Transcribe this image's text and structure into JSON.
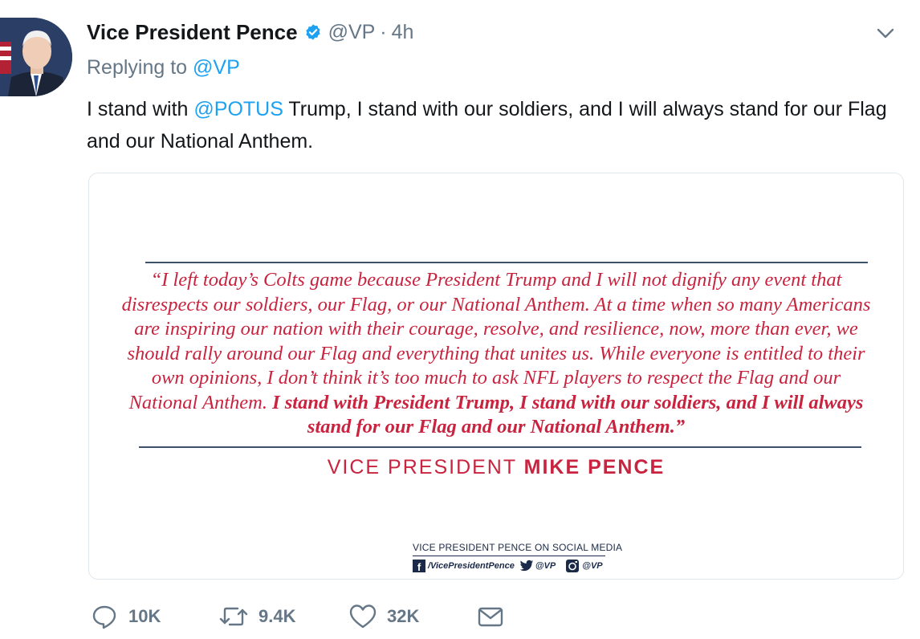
{
  "author": {
    "name": "Vice President Pence",
    "handle": "@VP",
    "separator": "·",
    "time": "4h",
    "verified": true,
    "avatar_icon": "profile-photo"
  },
  "reply": {
    "prefix": "Replying to",
    "to": "@VP"
  },
  "tweet": {
    "text_pre": "I stand with ",
    "mention": "@POTUS",
    "text_post": " Trump, I stand with our soldiers, and I will always stand for our Flag and our National Anthem."
  },
  "card": {
    "quote_regular": "“I left today’s Colts game because President Trump and I will not dignify any event that disrespects our soldiers, our Flag, or our National Anthem. At a time when so many Americans are inspiring our nation with their courage, resolve, and resilience, now, more than ever, we should rally around our Flag and everything that unites us. While everyone is entitled to their own opinions, I don’t think it’s too much to ask NFL players to respect the Flag and our National Anthem. ",
    "quote_bold": "I stand with President Trump, I stand with our soldiers, and I will always stand for our Flag and our National Anthem.”",
    "signature_title": "VICE PRESIDENT",
    "signature_name": "MIKE PENCE",
    "social_title": "VICE PRESIDENT PENCE ON SOCIAL MEDIA",
    "social_facebook": "/VicePresidentPence",
    "social_twitter": "@VP",
    "social_instagram": "@VP",
    "accent_color": "#c8233f",
    "rule_color": "#3d5268"
  },
  "actions": {
    "replies": "10K",
    "retweets": "9.4K",
    "likes": "32K"
  },
  "colors": {
    "link": "#1da1f2",
    "secondary_text": "#657786",
    "primary_text": "#14171a"
  }
}
